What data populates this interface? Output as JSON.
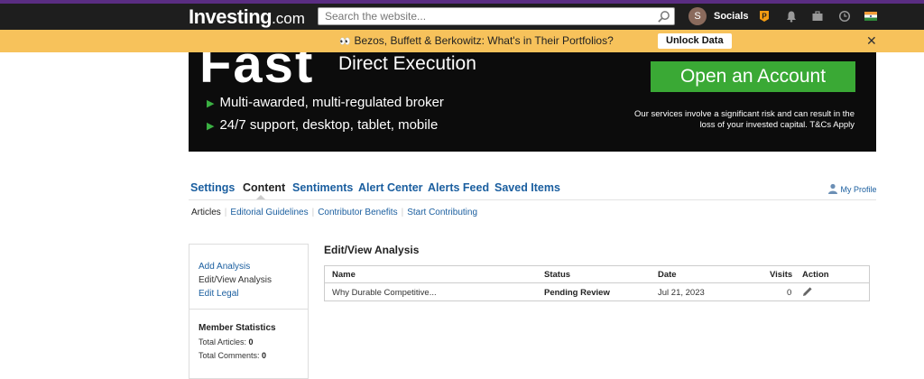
{
  "header": {
    "logo_main": "Investing",
    "logo_suffix": ".com",
    "search_placeholder": "Search the website...",
    "user_initial": "S",
    "user_name": "Socials",
    "icons": [
      "search-icon",
      "p-badge-icon",
      "bell-icon",
      "briefcase-icon",
      "clock-icon",
      "india-flag-icon"
    ]
  },
  "promo": {
    "text": "Bezos, Buffett & Berkowitz: What's in Their Portfolios?",
    "cta": "Unlock Data",
    "close": "✕"
  },
  "banner": {
    "big_word": "Fast",
    "headline": "Direct Execution",
    "bullet1": "Multi-awarded, multi-regulated broker",
    "bullet2": "24/7 support, desktop, tablet, mobile",
    "cta": "Open an Account",
    "risk": "Our services involve a significant risk and can result in the loss of your invested capital. T&Cs Apply"
  },
  "tabs": [
    "Settings",
    "Content",
    "Sentiments",
    "Alert Center",
    "Alerts Feed",
    "Saved Items"
  ],
  "active_tab": "Content",
  "my_profile": "My Profile",
  "subtabs": [
    "Articles",
    "Editorial Guidelines",
    "Contributor Benefits",
    "Start Contributing"
  ],
  "sidebar": {
    "links": [
      "Add Analysis",
      "Edit/View Analysis",
      "Edit Legal"
    ],
    "stats_title": "Member Statistics",
    "total_articles_label": "Total Articles:",
    "total_articles": "0",
    "total_comments_label": "Total Comments:",
    "total_comments": "0"
  },
  "main": {
    "title": "Edit/View Analysis",
    "columns": [
      "Name",
      "Status",
      "Date",
      "Visits",
      "Action"
    ],
    "rows": [
      {
        "name": "Why Durable Competitive...",
        "status": "Pending Review",
        "date": "Jul 21, 2023",
        "visits": "0"
      }
    ]
  },
  "colors": {
    "top_bar": "#1e1e1e",
    "promo_bar": "#f7c25b",
    "link_blue": "#1a5e9f",
    "cta_green": "#3aa935"
  }
}
